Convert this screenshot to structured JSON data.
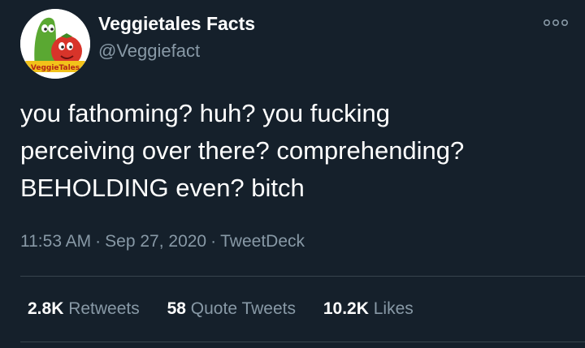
{
  "author": {
    "display_name": "Veggietales Facts",
    "handle": "@Veggiefact",
    "avatar_logo_text": "VeggieTales"
  },
  "tweet": {
    "text": "you fathoming? huh? you fucking\nperceiving over there? comprehending?\nBEHOLDING even? bitch",
    "time": "11:53 AM",
    "date": "Sep 27, 2020",
    "source": "TweetDeck",
    "separator": "·"
  },
  "stats": {
    "retweets_count": "2.8K",
    "retweets_label": "Retweets",
    "quote_count": "58",
    "quote_label": "Quote Tweets",
    "likes_count": "10.2K",
    "likes_label": "Likes"
  },
  "colors": {
    "background": "#15202b",
    "primary_text": "#ffffff",
    "secondary_text": "#8899a6",
    "divider": "#38444d"
  },
  "icons": {
    "more": "more-options-icon"
  }
}
